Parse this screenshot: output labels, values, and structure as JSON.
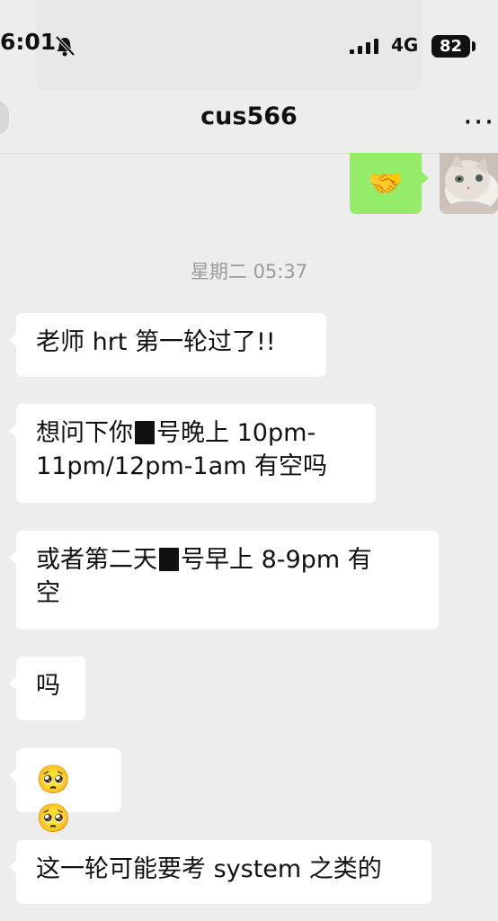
{
  "status": {
    "time": "6:01",
    "network": "4G",
    "battery": "82"
  },
  "header": {
    "title": "cus566",
    "more": "···"
  },
  "chat": {
    "sent_emoji": "🤝",
    "timestamp": "星期二 05:37",
    "messages": [
      {
        "text": "老师 hrt 第一轮过了!!"
      },
      {
        "line1_before": "想问下你",
        "line1_after": "号晚上 10pm-",
        "line2": "11pm/12pm-1am 有空吗"
      },
      {
        "line1_before": "或者第二天",
        "line1_after": "号早上 8-9pm 有",
        "line2": "空"
      },
      {
        "text": "吗"
      },
      {
        "emoji": "🥺🥺"
      },
      {
        "text": "这一轮可能要考 system 之类的"
      }
    ]
  },
  "icons": {
    "bell": "bell-off-icon",
    "signal": "signal-icon",
    "battery": "battery-icon",
    "avatar": "cat-avatar"
  }
}
